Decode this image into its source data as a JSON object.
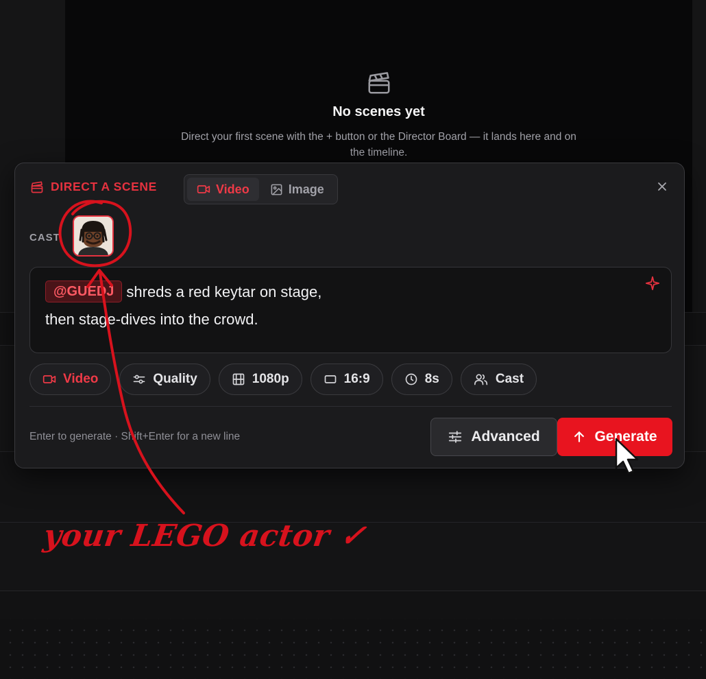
{
  "empty_state": {
    "title": "No scenes yet",
    "description": "Direct your first scene with the + button or the Director Board — it lands here and on the timeline."
  },
  "modal": {
    "title": "DIRECT A SCENE",
    "mode_tabs": [
      {
        "label": "Video",
        "icon": "video-icon",
        "active": true
      },
      {
        "label": "Image",
        "icon": "image-icon",
        "active": false
      }
    ],
    "cast_label": "CAST",
    "cast_member": "@GUEDJ",
    "prompt": {
      "mention": "@GUEDJ",
      "line1": "shreds a red keytar on stage,",
      "line2": "then stage-dives into the crowd."
    },
    "chips": [
      {
        "label": "Video",
        "icon": "video-icon",
        "accent": true
      },
      {
        "label": "Quality",
        "icon": "sliders-icon"
      },
      {
        "label": "1080p",
        "icon": "film-icon"
      },
      {
        "label": "16:9",
        "icon": "aspect-ratio-icon"
      },
      {
        "label": "8s",
        "icon": "clock-icon"
      },
      {
        "label": "Cast",
        "icon": "users-icon"
      }
    ],
    "hint": "Enter to generate · Shift+Enter for a new line",
    "advanced_label": "Advanced",
    "generate_label": "Generate"
  },
  "annotation": {
    "text": "your LEGO actor ✓"
  },
  "colors": {
    "accent": "#e5323f",
    "generate_bg": "#e8141f",
    "modal_bg": "#1b1b1d",
    "annotation": "#d7121d"
  }
}
